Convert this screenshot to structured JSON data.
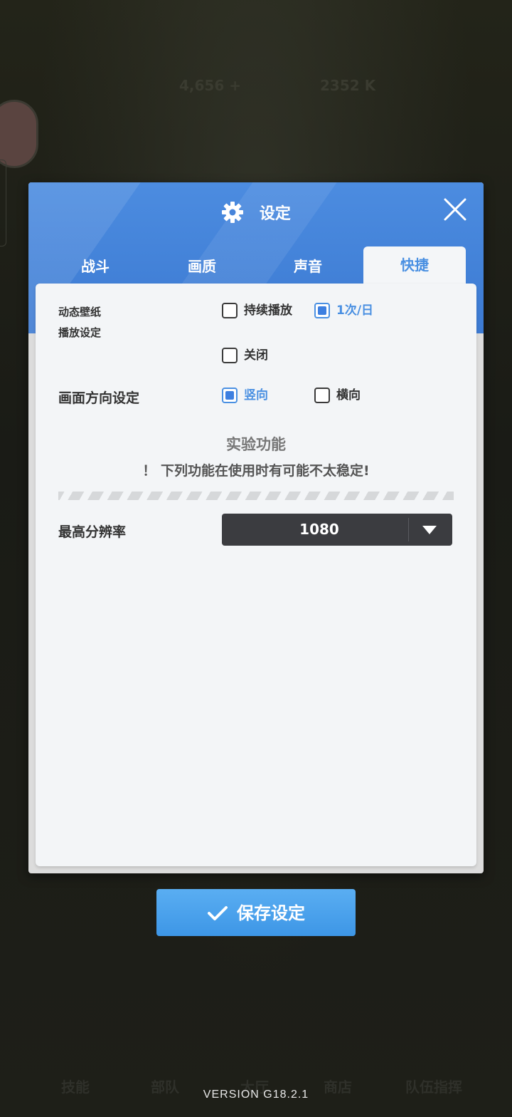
{
  "background": {
    "hud_values": [
      "4,656 +",
      "2352 K"
    ],
    "nav_items": [
      "技能",
      "部队",
      "大厅",
      "商店",
      "队伍指挥"
    ]
  },
  "dialog": {
    "title": "设定",
    "gear_icon": "gear-icon",
    "close_icon": "close-icon",
    "tabs": [
      {
        "label": "战斗",
        "active": false
      },
      {
        "label": "画质",
        "active": false
      },
      {
        "label": "声音",
        "active": false
      },
      {
        "label": "快捷",
        "active": true
      }
    ],
    "wallpaper": {
      "label_line1": "动态壁纸",
      "label_line2": "播放设定",
      "options": [
        {
          "label": "持续播放",
          "checked": false
        },
        {
          "label": "1次/日",
          "checked": true
        },
        {
          "label": "关闭",
          "checked": false
        }
      ]
    },
    "orientation": {
      "label": "画面方向设定",
      "options": [
        {
          "label": "竖向",
          "checked": true
        },
        {
          "label": "横向",
          "checked": false
        }
      ]
    },
    "experimental": {
      "title": "实验功能",
      "warning": "！ 下列功能在使用时有可能不太稳定!"
    },
    "resolution": {
      "label": "最高分辨率",
      "value": "1080"
    }
  },
  "save_button": {
    "label": "保存设定",
    "icon": "check-icon"
  },
  "version": "VERSION  G18.2.1",
  "colors": {
    "accent": "#4a90e2",
    "header": "#3c7ad2",
    "save": "#4aa3ee"
  }
}
